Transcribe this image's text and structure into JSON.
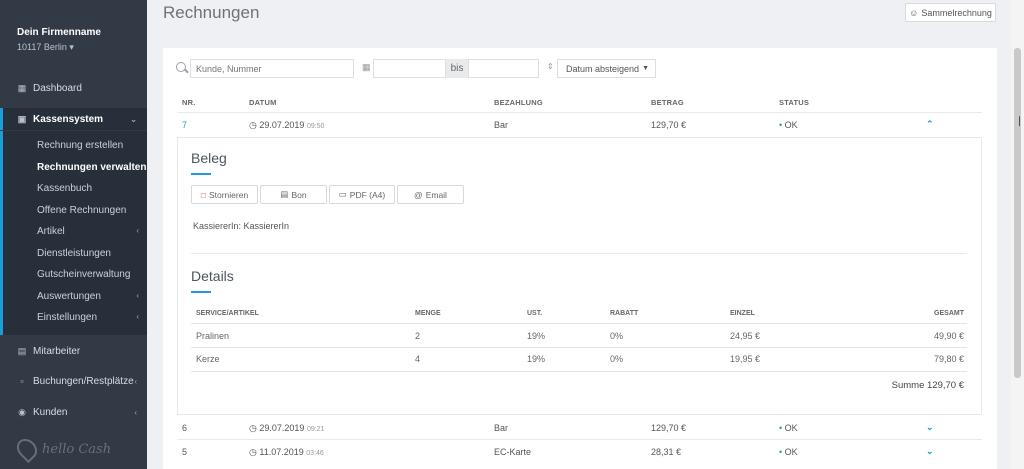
{
  "sidebar": {
    "company_name": "Dein Firmenname",
    "company_city": "10117 Berlin ▾",
    "dashboard": "Dashboard",
    "kassensystem": "Kassensystem",
    "sub_items": [
      "Rechnung erstellen",
      "Rechnungen verwalten",
      "Kassenbuch",
      "Offene Rechnungen",
      "Artikel",
      "Dienstleistungen",
      "Gutscheinverwaltung",
      "Auswertungen",
      "Einstellungen"
    ],
    "mitarbeiter": "Mitarbeiter",
    "buchungen": "Buchungen/Restplätze",
    "kunden": "Kunden",
    "logo_text": "hello Cash"
  },
  "header": {
    "title": "Rechnungen",
    "sammel_button": "Sammelrechnung"
  },
  "filters": {
    "search_placeholder": "Kunde, Nummer",
    "bis": "bis",
    "sort": "Datum absteigend"
  },
  "table": {
    "headers": [
      "NR.",
      "DATUM",
      "BEZAHLUNG",
      "BETRAG",
      "STATUS"
    ],
    "rows": [
      {
        "nr": "7",
        "date": "29.07.2019",
        "time": "09:50",
        "payment": "Bar",
        "amount": "129,70 €",
        "status": "OK"
      },
      {
        "nr": "6",
        "date": "29.07.2019",
        "time": "09:21",
        "payment": "Bar",
        "amount": "129,70 €",
        "status": "OK"
      },
      {
        "nr": "5",
        "date": "11.07.2019",
        "time": "03:46",
        "payment": "EC-Karte",
        "amount": "28,31 €",
        "status": "OK"
      }
    ]
  },
  "beleg": {
    "title": "Beleg",
    "buttons": [
      "Stornieren",
      "Bon",
      "PDF (A4)",
      "Email"
    ],
    "kassierer_label": "KassiererIn:",
    "kassierer_value": "KassiererIn"
  },
  "details": {
    "title": "Details",
    "headers": [
      "SERVICE/ARTIKEL",
      "MENGE",
      "UST.",
      "RABATT",
      "EINZEL",
      "GESAMT"
    ],
    "rows": [
      {
        "item": "Pralinen",
        "menge": "2",
        "ust": "19%",
        "rabatt": "0%",
        "einzel": "24,95 €",
        "gesamt": "49,90 €"
      },
      {
        "item": "Kerze",
        "menge": "4",
        "ust": "19%",
        "rabatt": "0%",
        "einzel": "19,95 €",
        "gesamt": "79,80 €"
      }
    ],
    "summe": "Summe 129,70 €"
  },
  "colors": {
    "accent": "#1f9bd7",
    "sidebar_bg": "#323a45",
    "status_ok": "#1fa87a"
  }
}
